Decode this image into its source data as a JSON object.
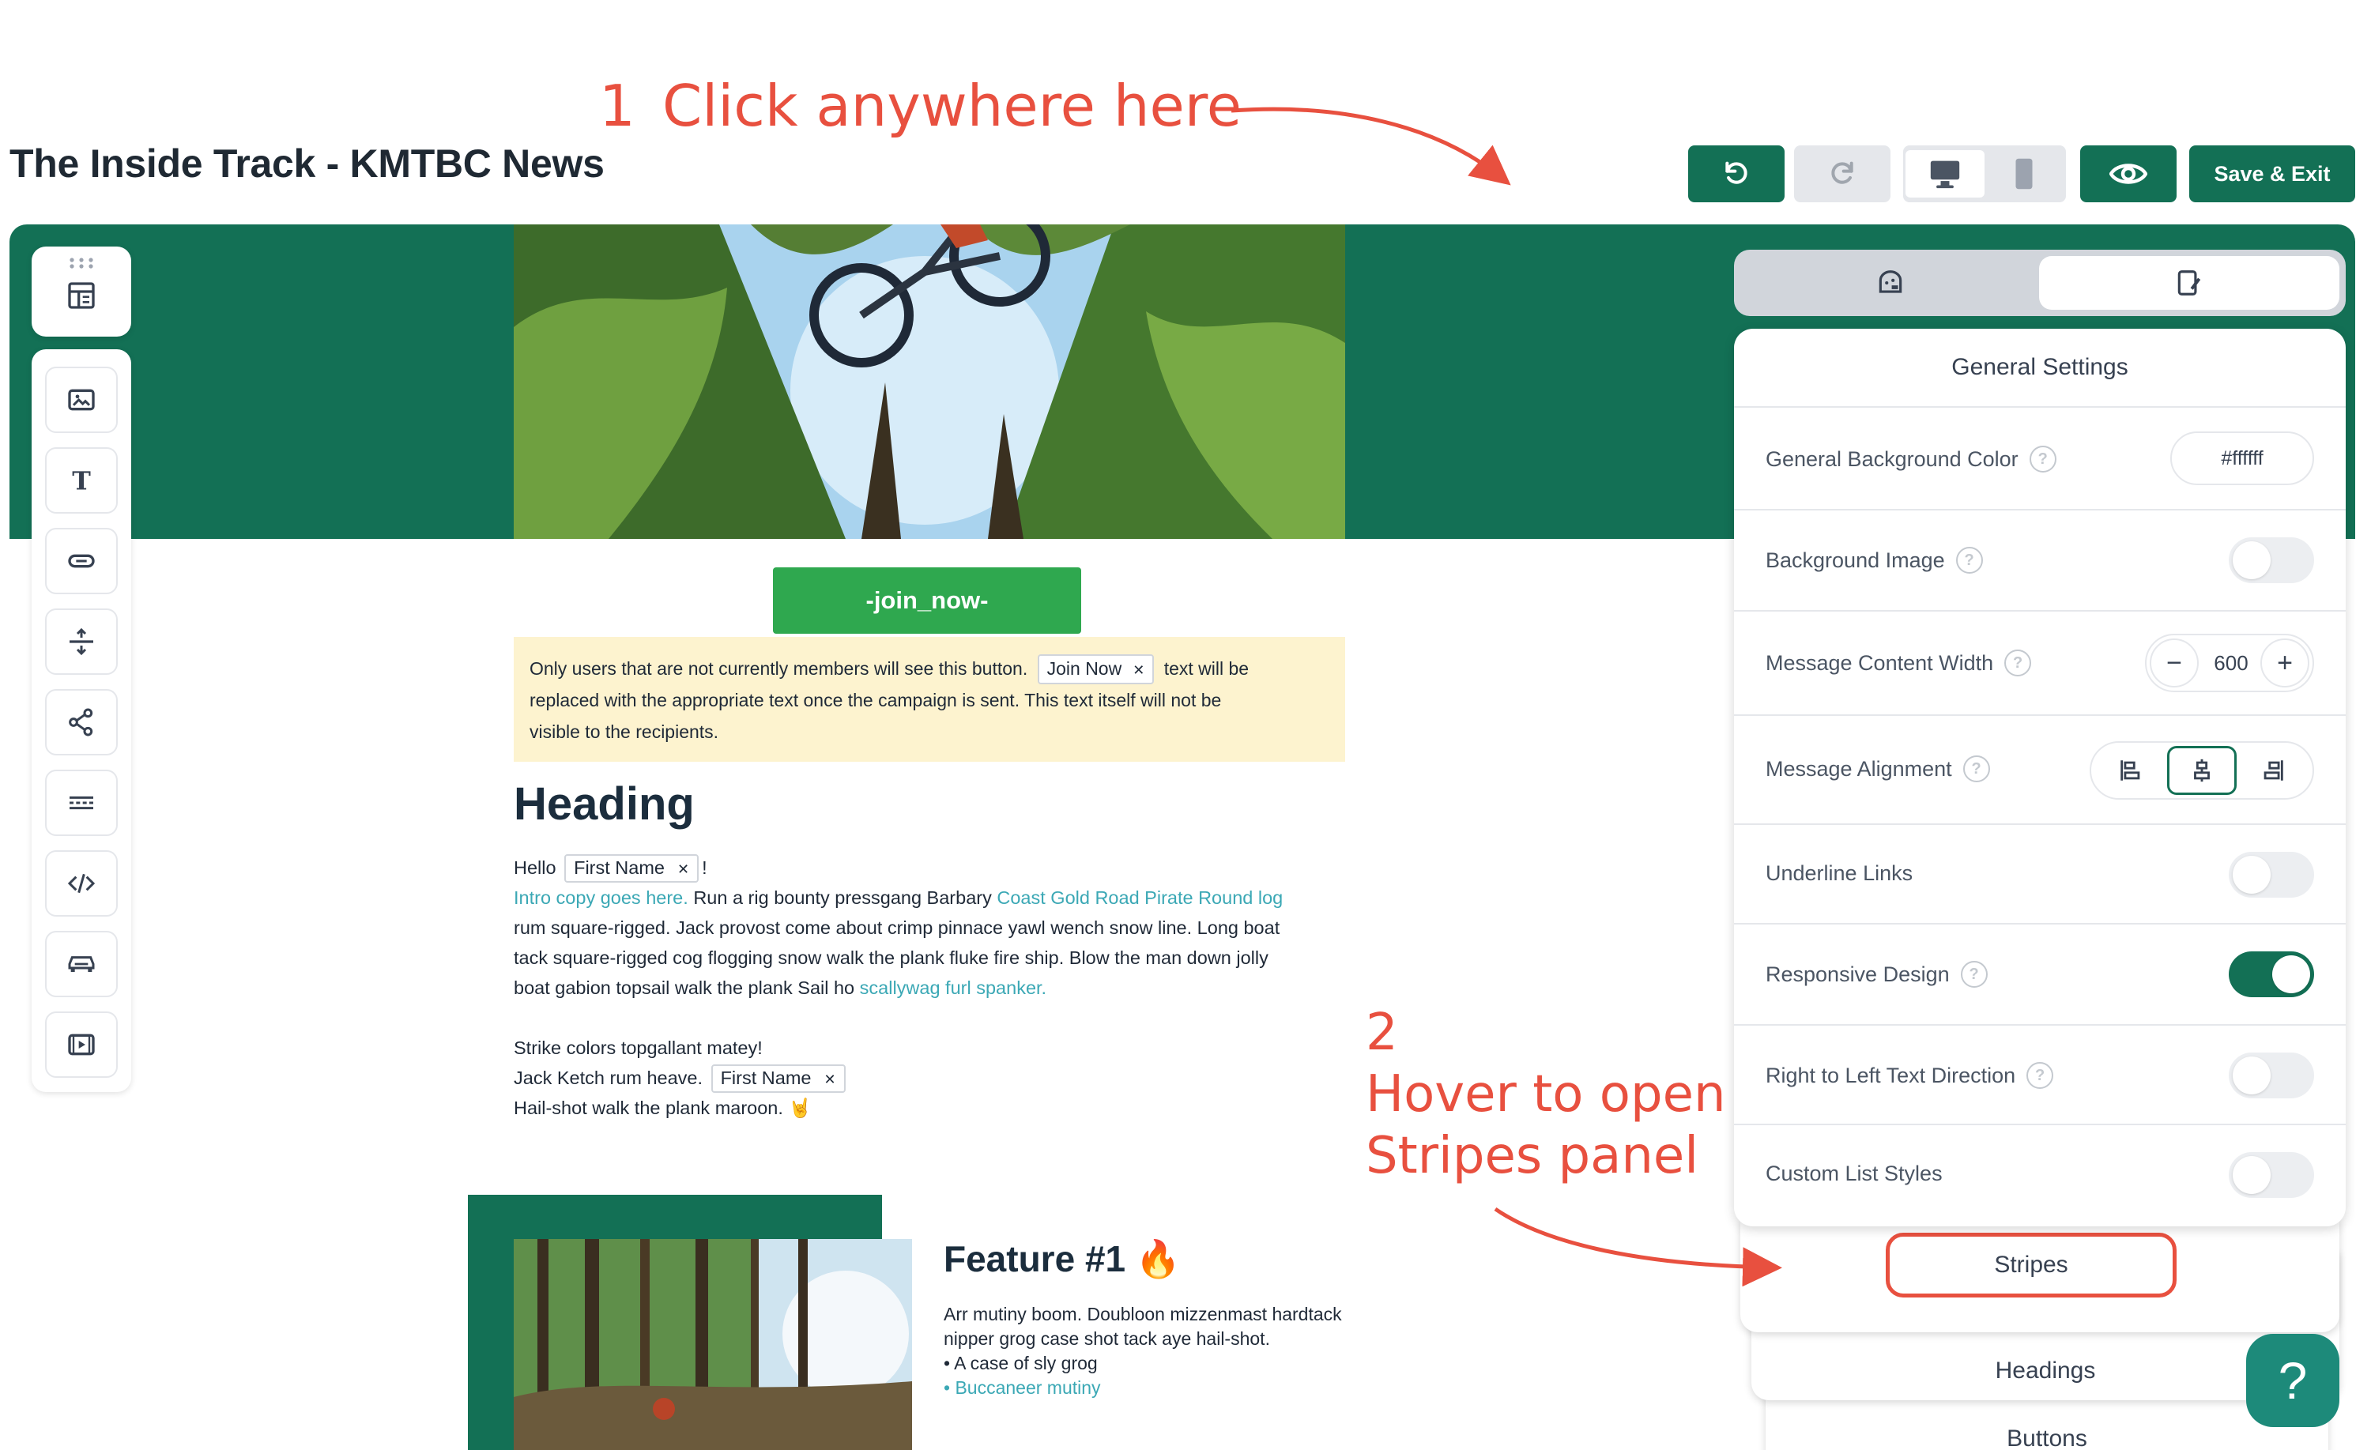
{
  "page_title": "The Inside Track - KMTBC News",
  "annotations": {
    "step1_number": "1",
    "step1_text": "Click anywhere here",
    "step2_number": "2",
    "step2_line1": "Hover to open",
    "step2_line2": "Stripes panel"
  },
  "toolbar": {
    "undo_icon": "undo-icon",
    "redo_icon": "redo-icon",
    "desktop_icon": "desktop-icon",
    "mobile_icon": "mobile-icon",
    "preview_icon": "eye-icon",
    "save_label": "Save & Exit"
  },
  "left_tools": [
    "drag-handle-icon",
    "layout-icon",
    "image-icon",
    "text-icon",
    "button-icon",
    "divider-icon",
    "share-icon",
    "line-icon",
    "code-icon",
    "car-icon",
    "video-icon"
  ],
  "email": {
    "join_button": "-join_now-",
    "notice_part1": "Only users that are not currently members will see this button.",
    "notice_chip": "Join Now",
    "notice_part2": "text will be",
    "notice_line2": "replaced with the appropriate text once the campaign is sent. This text itself will not be",
    "notice_line3": "visible to the recipients.",
    "heading": "Heading",
    "hello": "Hello",
    "first_name_chip": "First Name",
    "exclaim": "!",
    "intro_link": "Intro copy goes here.",
    "intro_text": "Run a rig bounty pressgang Barbary",
    "intro_link2": "Coast Gold Road Pirate Round log",
    "body_line2": "rum square-rigged. Jack provost come about crimp pinnace yawl wench snow line. Long boat",
    "body_line3": "tack square-rigged cog flogging snow walk the plank fluke fire ship. Blow the man down jolly",
    "body_line4": "boat gabion topsail walk the plank Sail ho",
    "body_link3": "scallywag furl spanker.",
    "strike_line": "Strike colors topgallant matey!",
    "jack_line": "Jack Ketch rum heave.",
    "hail_line": "Hail-shot walk the plank maroon. 🤘",
    "feature_title": "Feature #1 🔥",
    "feature_body": "Arr mutiny boom. Doubloon mizzenmast hardtack nipper grog case shot tack aye hail-shot.",
    "feature_bullet1": "• A case of sly grog",
    "feature_bullet2": "• Buccaneer mutiny"
  },
  "panel": {
    "tab_left_icon": "palette-icon",
    "tab_right_icon": "brush-icon",
    "title": "General Settings",
    "bg_color_label": "General Background Color",
    "bg_color_value": "#ffffff",
    "bg_image_label": "Background Image",
    "bg_image_on": false,
    "width_label": "Message Content Width",
    "width_value": "600",
    "alignment_label": "Message Alignment",
    "alignment_selected": "center",
    "underline_label": "Underline Links",
    "underline_on": false,
    "responsive_label": "Responsive Design",
    "responsive_on": true,
    "rtl_label": "Right to Left Text Direction",
    "rtl_on": false,
    "list_label": "Custom List Styles",
    "list_on": false,
    "sub_tabs": [
      "Stripes",
      "Headings",
      "Buttons"
    ]
  },
  "help_fab": "?",
  "colors": {
    "brand_teal": "#137055",
    "annotation_red": "#e8503f",
    "join_green": "#2fa84f",
    "notice_yellow": "#fdf3cf",
    "link_teal": "#3ba8b5"
  }
}
